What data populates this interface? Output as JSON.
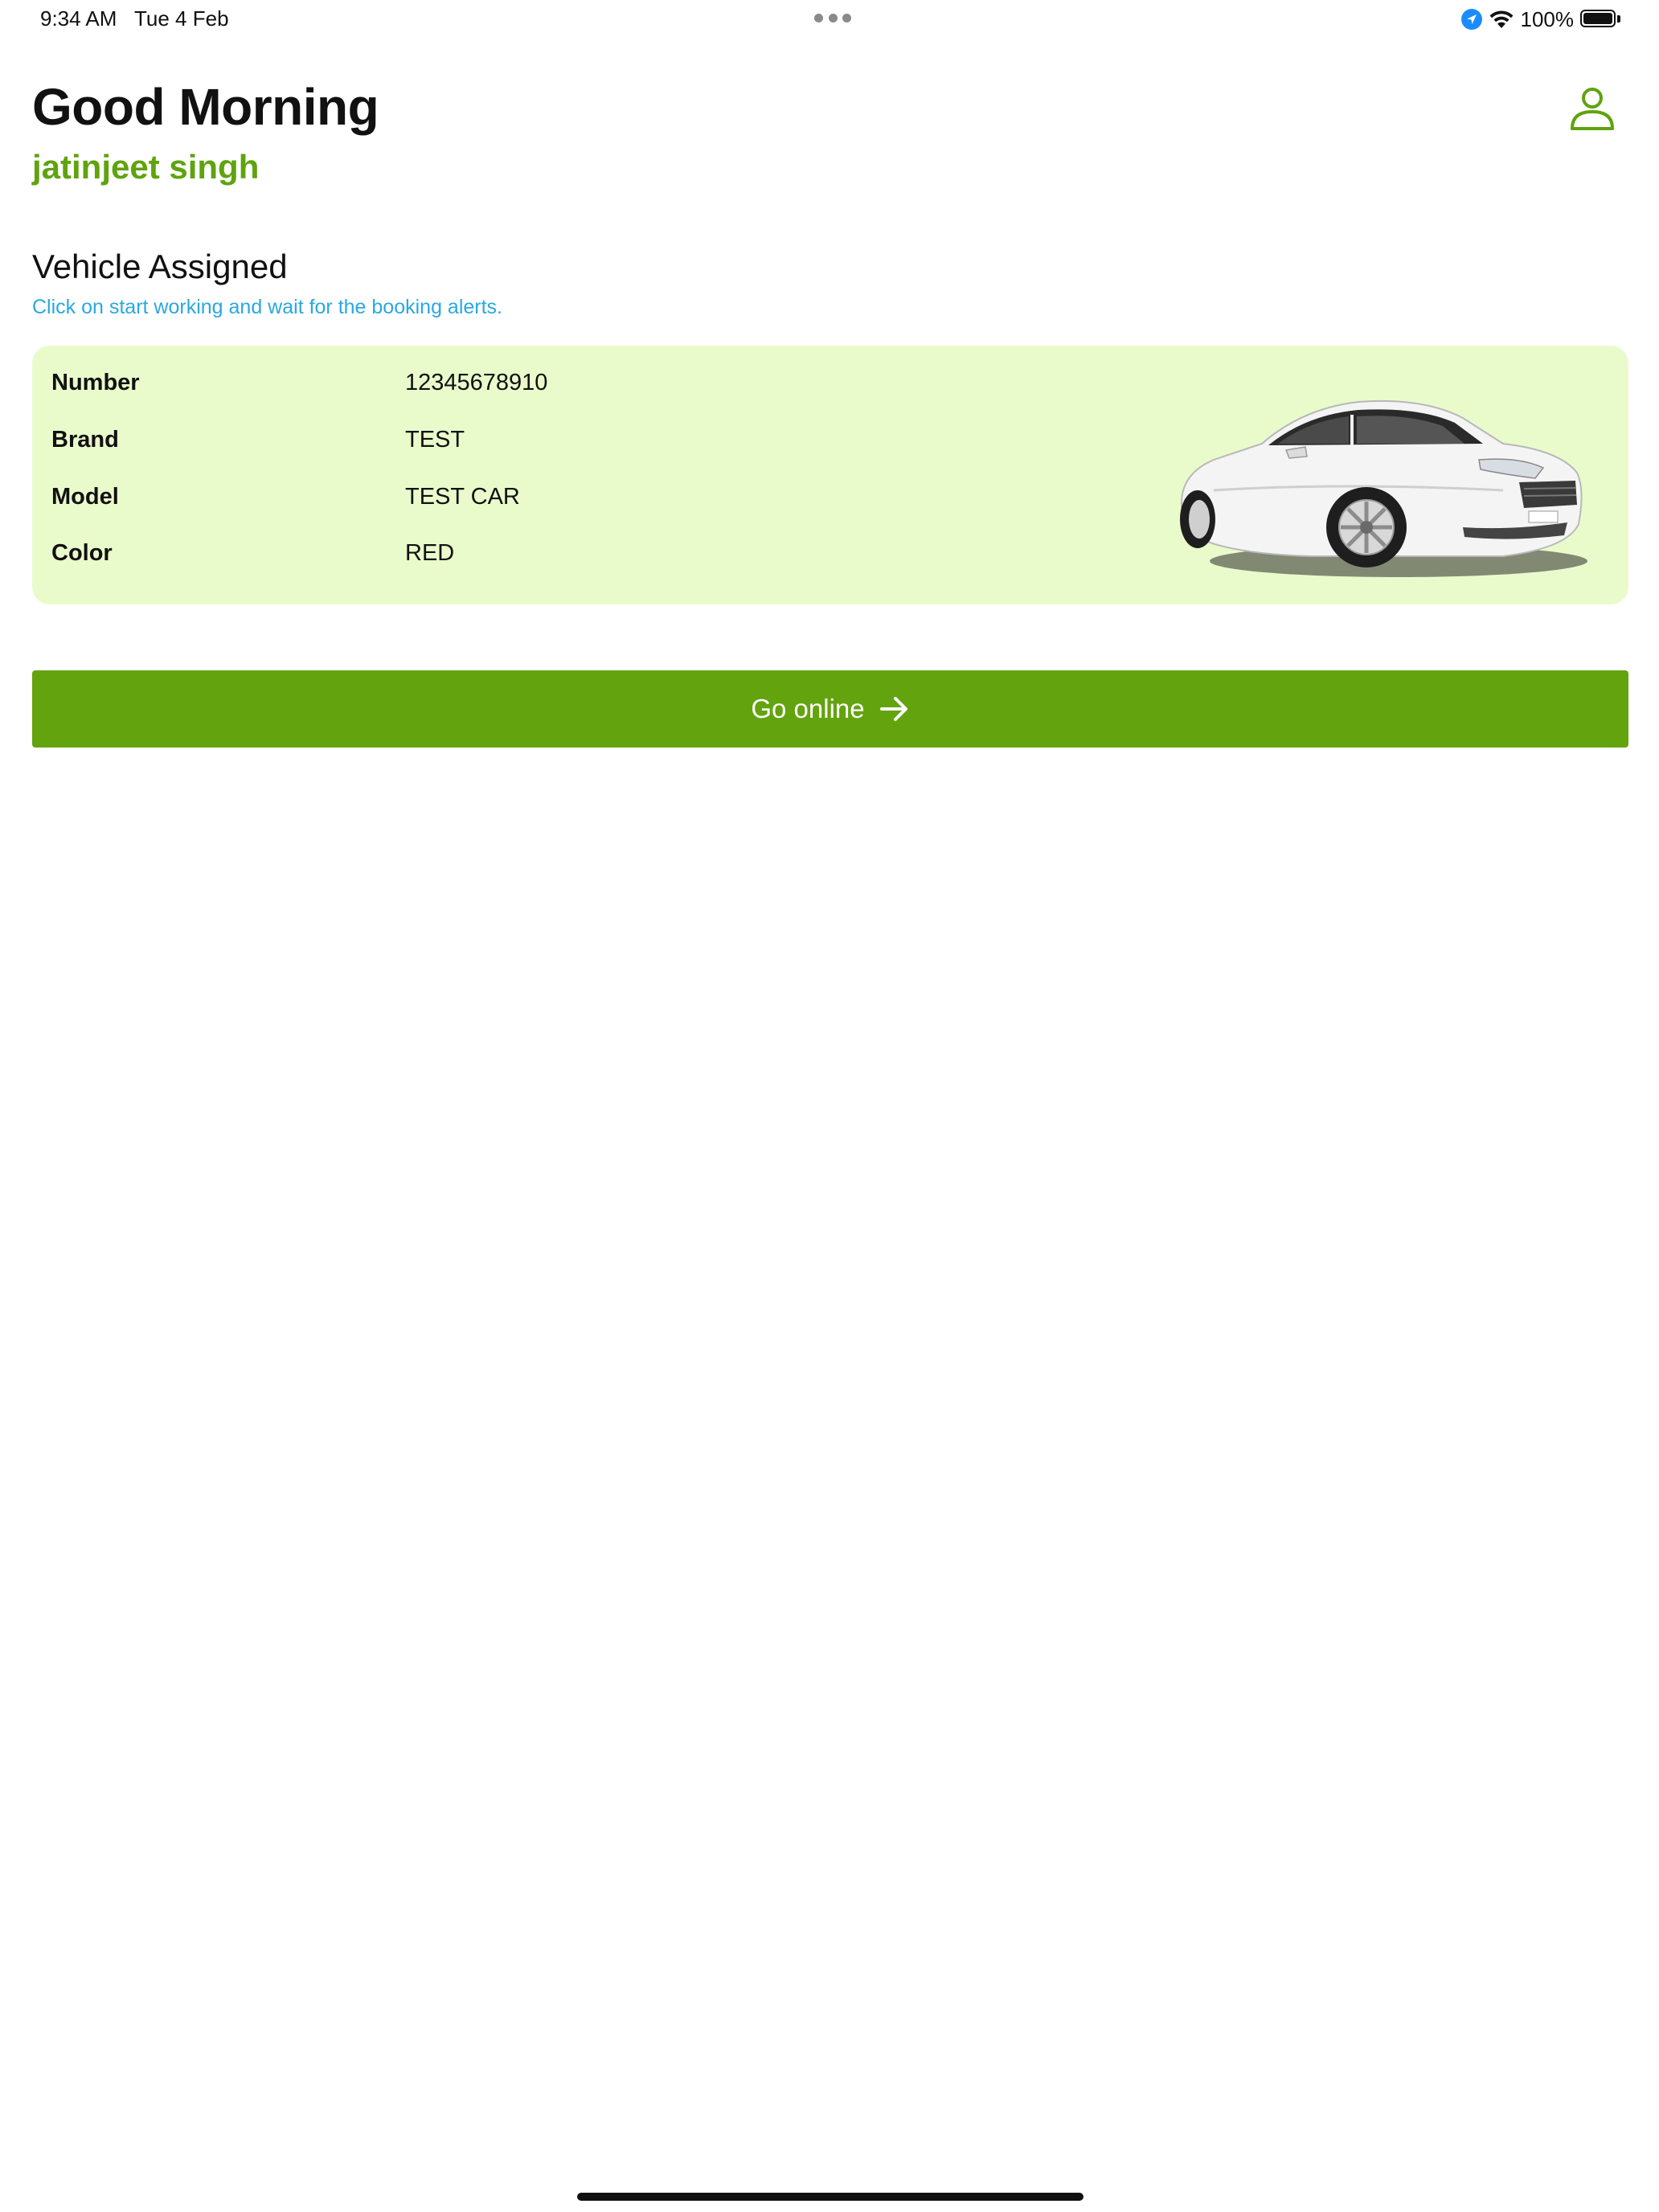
{
  "status_bar": {
    "time": "9:34 AM",
    "date": "Tue 4 Feb",
    "battery_percent": "100%",
    "battery_level": 1.0,
    "icons": [
      "location-icon",
      "wifi-icon",
      "battery-icon"
    ]
  },
  "header": {
    "greeting": "Good Morning",
    "user_name": "jatinjeet singh",
    "profile_icon": "person-icon"
  },
  "vehicle": {
    "section_title": "Vehicle Assigned",
    "subtitle": "Click on start working and wait for the booking alerts.",
    "rows": [
      {
        "label": "Number",
        "value": "12345678910"
      },
      {
        "label": "Brand",
        "value": "TEST"
      },
      {
        "label": "Model",
        "value": "TEST CAR"
      },
      {
        "label": "Color",
        "value": "RED"
      }
    ],
    "image": "white-car"
  },
  "actions": {
    "go_online_label": "Go online",
    "go_online_icon": "arrow-right-icon"
  },
  "colors": {
    "accent_green": "#63a30e",
    "name_green": "#5fa30e",
    "card_background": "#eafbcb",
    "subtitle_blue": "#2aa8e0"
  }
}
